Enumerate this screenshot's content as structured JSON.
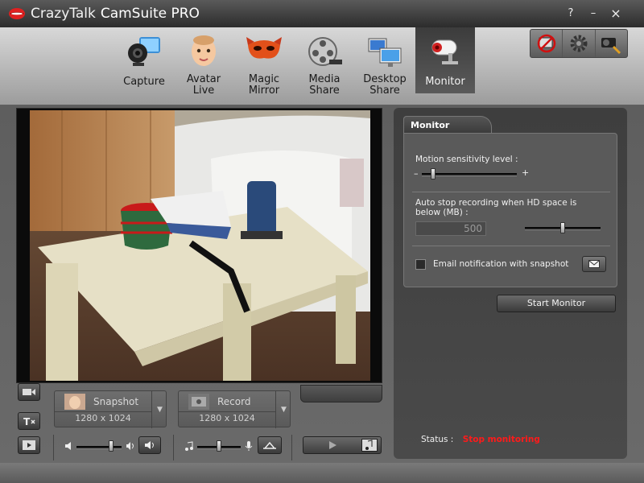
{
  "window": {
    "title_brand": "CrazyTalk",
    "title_product": "CamSuite PRO",
    "help_label": "?",
    "minimize_label": "–",
    "close_label": "×"
  },
  "nav": {
    "tabs": [
      {
        "label": "Capture",
        "icon": "webcam-icon"
      },
      {
        "label": "Avatar\nLive",
        "icon": "baby-avatar-icon"
      },
      {
        "label": "Magic\nMirror",
        "icon": "mask-icon"
      },
      {
        "label": "Media\nShare",
        "icon": "film-reel-icon"
      },
      {
        "label": "Desktop\nShare",
        "icon": "monitors-icon"
      },
      {
        "label": "Monitor",
        "icon": "security-camera-icon"
      }
    ],
    "active_tab": "Monitor",
    "tools": [
      "no-webcam-icon",
      "gear-icon",
      "camera-settings-icon"
    ]
  },
  "panel": {
    "tab_title": "Monitor",
    "motion_label": "Motion sensitivity level :",
    "motion_minus": "–",
    "motion_plus": "+",
    "motion_level": 0.1,
    "autostop_label": "Auto stop recording when HD space is below (MB) :",
    "autostop_value": "500",
    "autostop_slider_level": 0.5,
    "email_label": "Email notification with snapshot",
    "email_checked": false,
    "start_button": "Start Monitor",
    "status_label": "Status :",
    "status_value": "Stop monitoring",
    "status_color": "#ff1a1a"
  },
  "capture": {
    "snapshot_label": "Snapshot",
    "snapshot_res": "1280 x 1024",
    "record_label": "Record",
    "record_res": "1280 x 1024",
    "volume_level": 0.8,
    "mic_level": 0.5
  }
}
